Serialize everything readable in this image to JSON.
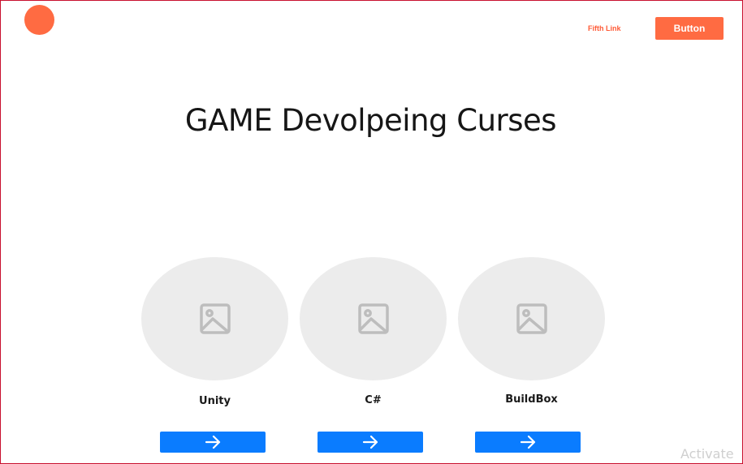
{
  "header": {
    "nav_link_label": "Fifth Link",
    "button_label": "Button"
  },
  "main": {
    "title": "GAME Devolpeing Curses",
    "courses": [
      {
        "label": "Unity",
        "image_icon": "image-placeholder-icon",
        "action_icon": "arrow-right-icon"
      },
      {
        "label": "C#",
        "image_icon": "image-placeholder-icon",
        "action_icon": "arrow-right-icon"
      },
      {
        "label": "BuildBox",
        "image_icon": "image-placeholder-icon",
        "action_icon": "arrow-right-icon"
      }
    ]
  },
  "watermark": {
    "text": "Activate"
  },
  "colors": {
    "accent": "#ff6b42",
    "link": "#ff5a36",
    "primary_button": "#0a7cff",
    "placeholder_bg": "#ececec",
    "placeholder_icon": "#bdbdbd",
    "frame_border": "#c8102e"
  }
}
